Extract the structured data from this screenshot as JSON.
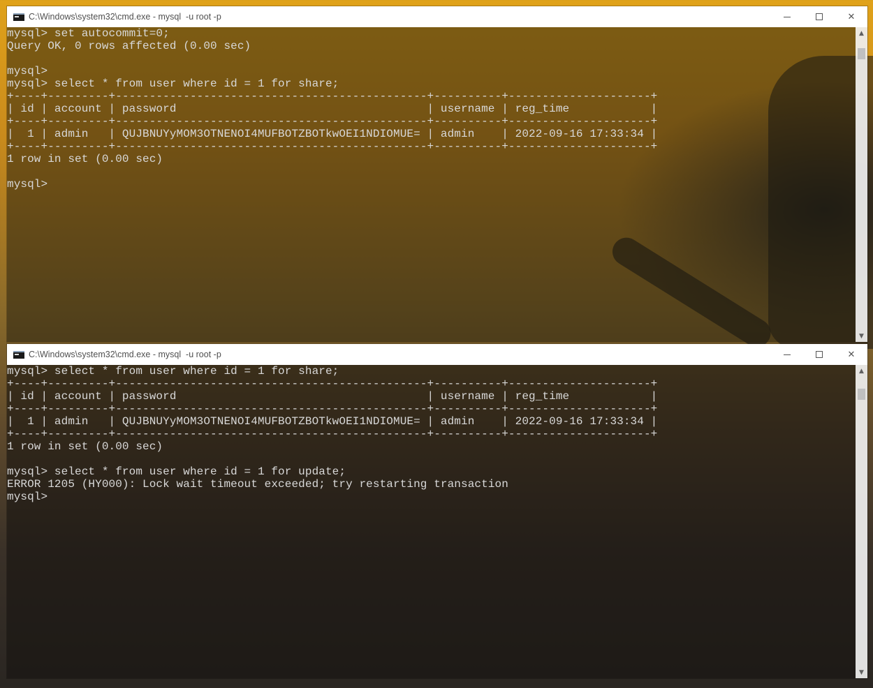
{
  "window_top": {
    "title": "C:\\Windows\\system32\\cmd.exe - mysql  -u root -p",
    "lines": [
      "mysql> set autocommit=0;",
      "Query OK, 0 rows affected (0.00 sec)",
      "",
      "mysql>",
      "mysql> select * from user where id = 1 for share;",
      "+----+---------+----------------------------------------------+----------+---------------------+",
      "| id | account | password                                     | username | reg_time            |",
      "+----+---------+----------------------------------------------+----------+---------------------+",
      "|  1 | admin   | QUJBNUYyMOM3OTNENOI4MUFBOTZBOTkwOEI1NDIOMUE= | admin    | 2022-09-16 17:33:34 |",
      "+----+---------+----------------------------------------------+----------+---------------------+",
      "1 row in set (0.00 sec)",
      "",
      "mysql>"
    ]
  },
  "window_bottom": {
    "title": "C:\\Windows\\system32\\cmd.exe - mysql  -u root -p",
    "lines": [
      "mysql> select * from user where id = 1 for share;",
      "+----+---------+----------------------------------------------+----------+---------------------+",
      "| id | account | password                                     | username | reg_time            |",
      "+----+---------+----------------------------------------------+----------+---------------------+",
      "|  1 | admin   | QUJBNUYyMOM3OTNENOI4MUFBOTZBOTkwOEI1NDIOMUE= | admin    | 2022-09-16 17:33:34 |",
      "+----+---------+----------------------------------------------+----------+---------------------+",
      "1 row in set (0.00 sec)",
      "",
      "mysql> select * from user where id = 1 for update;",
      "ERROR 1205 (HY000): Lock wait timeout exceeded; try restarting transaction",
      "mysql>"
    ]
  },
  "controls": {
    "close_glyph": "✕",
    "scroll_up_glyph": "▲",
    "scroll_down_glyph": "▼"
  },
  "icons": {
    "window_icon": "cmd-icon",
    "minimize": "minimize-icon",
    "maximize": "maximize-icon",
    "close": "close-icon"
  }
}
